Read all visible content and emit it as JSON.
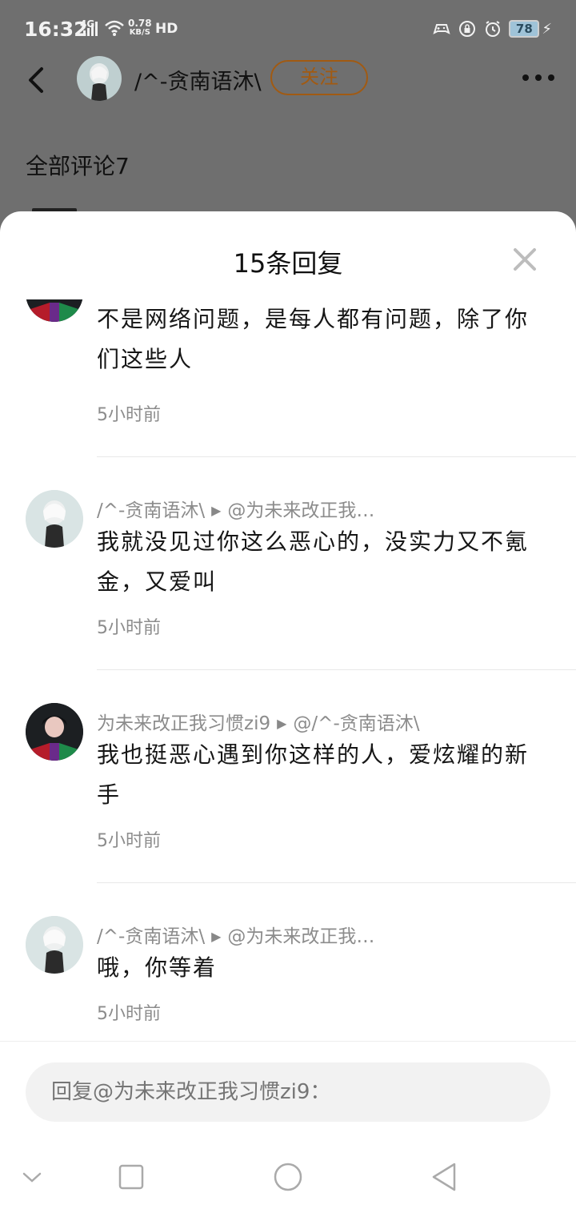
{
  "status_bar": {
    "time": "16:32",
    "network": "4G",
    "speed_value": "0.78",
    "speed_unit": "KB/S",
    "hd": "HD",
    "battery": "78"
  },
  "nav": {
    "username": "/^-贪南语沐\\",
    "follow_label": "关注"
  },
  "background": {
    "all_comments": "全部评论7"
  },
  "sheet": {
    "title": "15条回复"
  },
  "replies": [
    {
      "author": "",
      "target": "",
      "text": "不是网络问题，是每人都有问题，除了你们这些人",
      "time": "5小时前"
    },
    {
      "author": "/^-贪南语沐\\",
      "target": "@为未来改正我…",
      "text": "我就没见过你这么恶心的，没实力又不氪金，又爱叫",
      "time": "5小时前"
    },
    {
      "author": "为未来改正我习惯zi9",
      "target": "@/^-贪南语沐\\",
      "text": "我也挺恶心遇到你这样的人，爱炫耀的新手",
      "time": "5小时前"
    },
    {
      "author": "/^-贪南语沐\\",
      "target": "@为未来改正我…",
      "text": "哦，你等着",
      "time": "5小时前"
    }
  ],
  "reply_input": {
    "placeholder": "回复@为未来改正我习惯zi9："
  }
}
